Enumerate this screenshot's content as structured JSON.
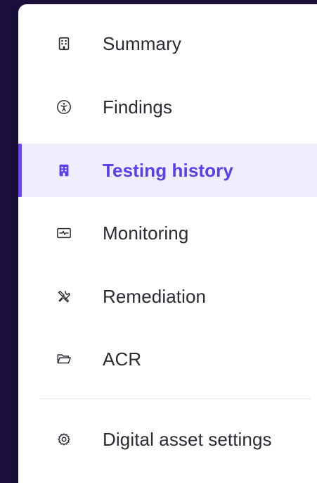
{
  "nav": {
    "items": [
      {
        "label": "Summary",
        "icon": "building-grid-icon",
        "active": false
      },
      {
        "label": "Findings",
        "icon": "accessibility-icon",
        "active": false
      },
      {
        "label": "Testing history",
        "icon": "building-icon",
        "active": true
      },
      {
        "label": "Monitoring",
        "icon": "pulse-monitor-icon",
        "active": false
      },
      {
        "label": "Remediation",
        "icon": "tools-icon",
        "active": false
      },
      {
        "label": "ACR",
        "icon": "folder-icon",
        "active": false
      }
    ],
    "settings": {
      "label": "Digital asset settings",
      "icon": "gear-icon"
    }
  },
  "colors": {
    "accent": "#5b3ef0",
    "active_background": "#eeeefc",
    "text": "#2b2b33",
    "backdrop": "#1a0f3a"
  }
}
